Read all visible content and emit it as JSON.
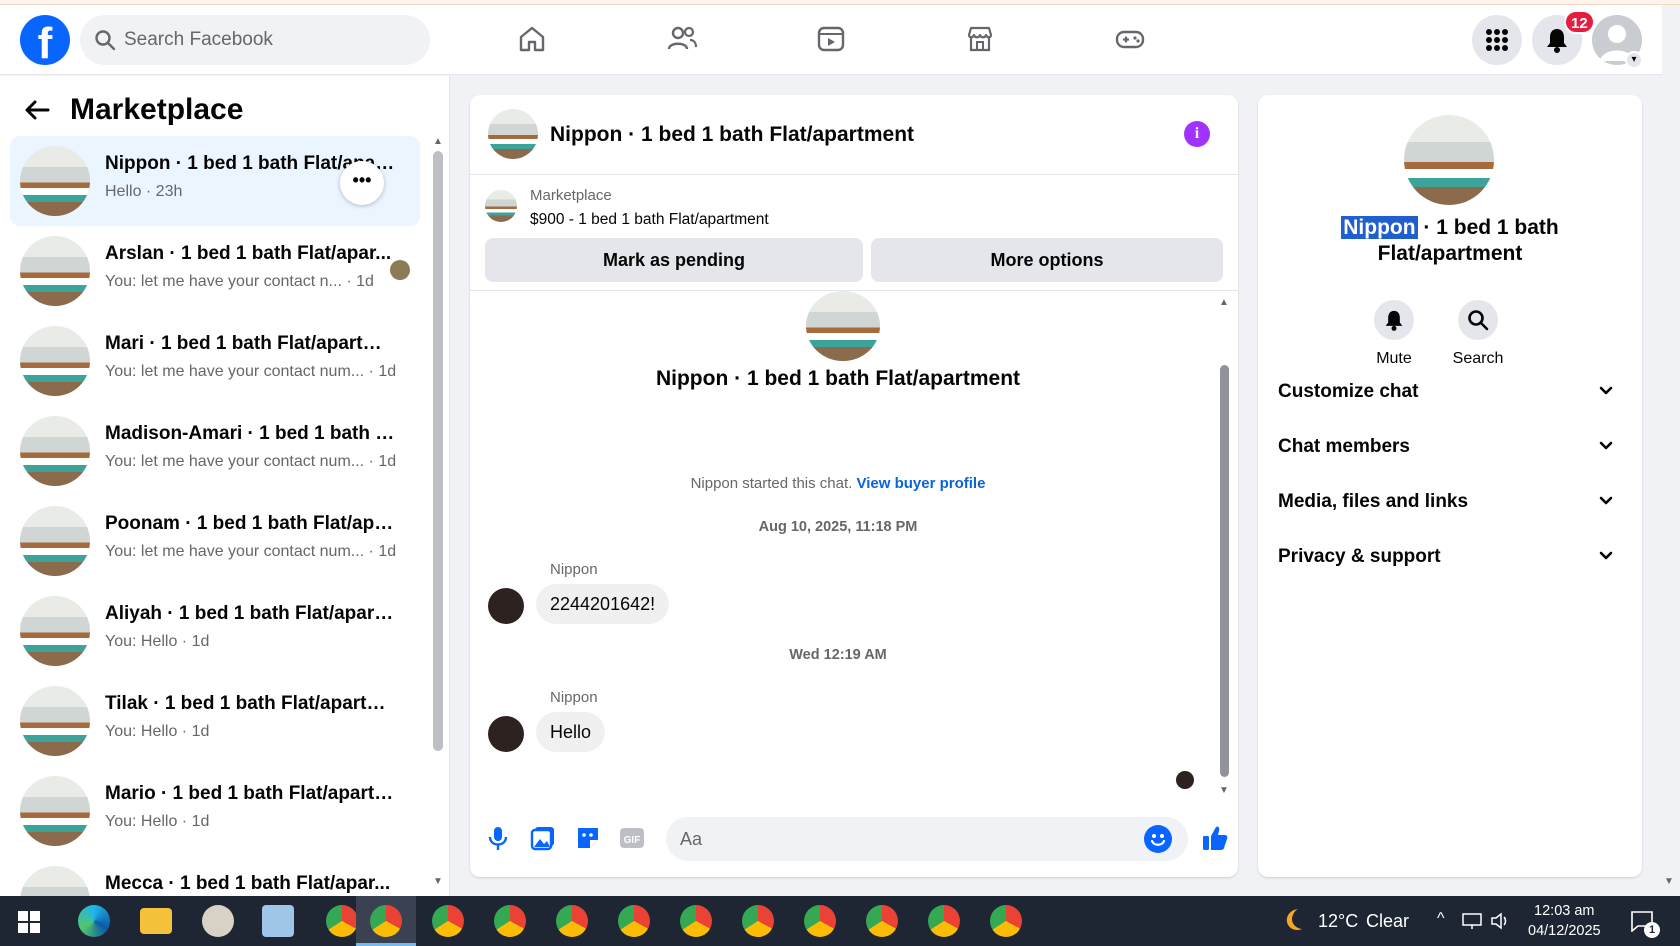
{
  "topbar": {
    "logo": "f",
    "search_placeholder": "Search Facebook",
    "nav_icons": [
      "home-icon",
      "friends-icon",
      "video-icon",
      "marketplace-icon",
      "gaming-icon"
    ],
    "menu_icon": "grid-menu-icon",
    "notifications_count": "12",
    "accent": "#0866ff"
  },
  "sidebar": {
    "title": "Marketplace",
    "conversations": [
      {
        "title": "Nippon · 1 bed 1 bath Flat/apartment",
        "snippet": "Hello · 23h",
        "active": true
      },
      {
        "title": "Arslan · 1 bed 1 bath Flat/apar...",
        "snippet": "You: let me have your contact n... · 1d"
      },
      {
        "title": "Mari · 1 bed 1 bath Flat/apartment",
        "snippet": "You: let me have your contact num... · 1d"
      },
      {
        "title": "Madison-Amari · 1 bed 1 bath Fl...",
        "snippet": "You: let me have your contact num... · 1d"
      },
      {
        "title": "Poonam · 1 bed 1 bath Flat/apart...",
        "snippet": "You: let me have your contact num... · 1d"
      },
      {
        "title": "Aliyah · 1 bed 1 bath Flat/apartm...",
        "snippet": "You: Hello · 1d"
      },
      {
        "title": "Tilak · 1 bed 1 bath Flat/apartment",
        "snippet": "You: Hello · 1d"
      },
      {
        "title": "Mario · 1 bed 1 bath Flat/apartm...",
        "snippet": "You: Hello · 1d"
      },
      {
        "title": "Mecca · 1 bed 1 bath Flat/apar...",
        "snippet": ""
      }
    ],
    "more_label": "•••"
  },
  "chat": {
    "header_title": "Nippon · 1 bed 1 bath Flat/apartment",
    "info_label": "i",
    "listing_label": "Marketplace",
    "listing_price": "$900 - 1 bed 1 bath Flat/apartment",
    "btn_pending": "Mark as pending",
    "btn_more": "More options",
    "hero_title": "Nippon · 1 bed 1 bath Flat/apartment",
    "started_text": "Nippon started this chat.",
    "view_profile": "View buyer profile",
    "stamp1": "Aug 10, 2025, 11:18 PM",
    "msg1_sender": "Nippon",
    "msg1_text": "2244201642!",
    "stamp2": "Wed 12:19 AM",
    "msg2_sender": "Nippon",
    "msg2_text": "Hello",
    "composer_placeholder": "Aa"
  },
  "details": {
    "name_highlight": "Nippon",
    "name_rest": " · 1 bed 1 bath Flat/apartment",
    "mute_label": "Mute",
    "search_label": "Search",
    "sections": [
      "Customize chat",
      "Chat members",
      "Media, files and links",
      "Privacy & support"
    ]
  },
  "taskbar": {
    "weather_temp": "12°C",
    "weather_desc": "Clear",
    "time": "12:03 am",
    "date": "04/12/2025",
    "notification_count": "1"
  }
}
